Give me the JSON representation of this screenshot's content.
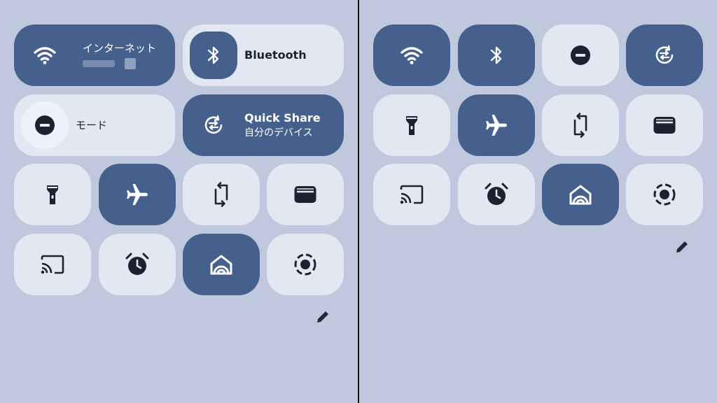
{
  "left_panel": {
    "internet": {
      "label": "インターネット"
    },
    "bluetooth": {
      "label": "Bluetooth"
    },
    "dnd": {
      "label": "モード"
    },
    "quick_share": {
      "title": "Quick Share",
      "subtitle": "自分のデバイス"
    }
  },
  "colors": {
    "background": "#bfc8dc",
    "tile_on": "#46608e",
    "tile_off": "#e3e7f1",
    "divider": "#111111"
  },
  "icons": [
    "wifi-icon",
    "bluetooth-icon",
    "do-not-disturb-icon",
    "quick-share-icon",
    "flashlight-icon",
    "airplane-icon",
    "auto-rotate-icon",
    "wallet-icon",
    "cast-icon",
    "alarm-icon",
    "home-icon",
    "screen-record-icon",
    "edit-pencil-icon"
  ]
}
